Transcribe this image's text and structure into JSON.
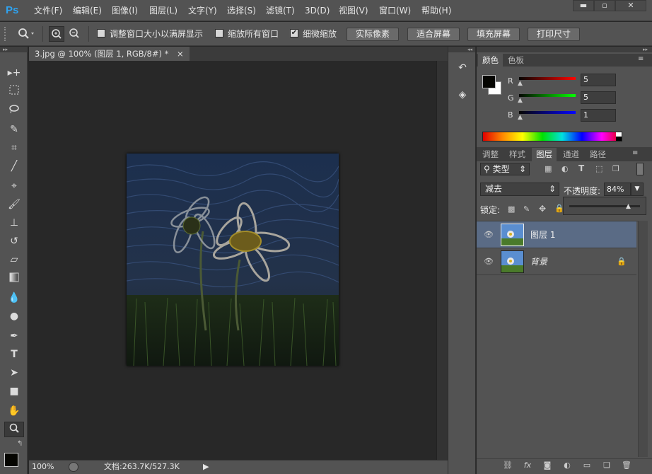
{
  "app": {
    "logo": "Ps"
  },
  "menu": [
    "文件(F)",
    "编辑(E)",
    "图像(I)",
    "图层(L)",
    "文字(Y)",
    "选择(S)",
    "滤镜(T)",
    "3D(D)",
    "视图(V)",
    "窗口(W)",
    "帮助(H)"
  ],
  "window_controls": {
    "minimize": "▬",
    "maximize": "▫",
    "close": "✕"
  },
  "options": {
    "zoom_in_icon": "zoom-in-icon",
    "zoom_out_icon": "zoom-out-icon",
    "resize_windows_label": "调整窗口大小以满屏显示",
    "resize_windows_checked": false,
    "zoom_all_label": "缩放所有窗口",
    "zoom_all_checked": false,
    "scrubby_label": "细微缩放",
    "scrubby_checked": true,
    "buttons": [
      "实际像素",
      "适合屏幕",
      "填充屏幕",
      "打印尺寸"
    ]
  },
  "document": {
    "tab_title": "3.jpg @ 100% (图层 1, RGB/8#) *",
    "tab_close": "×"
  },
  "status": {
    "zoom": "100%",
    "doc_info": "文档:263.7K/527.3K",
    "arrow": "▶"
  },
  "color_panel": {
    "tabs": [
      "颜色",
      "色板"
    ],
    "channels": [
      {
        "label": "R",
        "value": "5"
      },
      {
        "label": "G",
        "value": "5"
      },
      {
        "label": "B",
        "value": "1"
      }
    ],
    "foreground": "#050501",
    "background": "#ffffff"
  },
  "layers_panel": {
    "tabs": [
      "调整",
      "样式",
      "图层",
      "通道",
      "路径"
    ],
    "active_tab": 2,
    "filter_label": "类型",
    "blend_mode": "减去",
    "opacity_label": "不透明度:",
    "opacity_value": "84%",
    "opacity_fraction": 0.84,
    "lock_label": "锁定:",
    "layers": [
      {
        "name": "图层 1",
        "selected": true,
        "locked": false
      },
      {
        "name": "背景",
        "selected": false,
        "locked": true
      }
    ]
  },
  "colors": {
    "accent": "#5a6b85",
    "logo": "#2fa3f0"
  }
}
